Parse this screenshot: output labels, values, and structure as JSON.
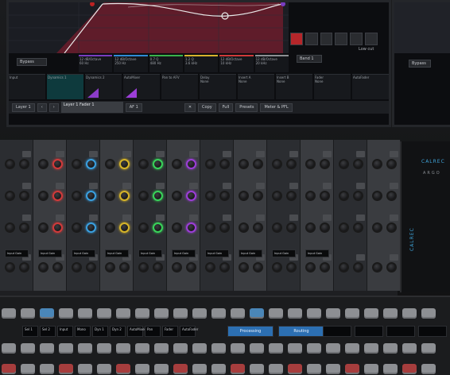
{
  "main_screen": {
    "eq": {
      "curve_color": "#e4e4e4",
      "fill_color": "#6b1c2c",
      "bypass_label": "Bypass",
      "band_label": "Band 1",
      "lowcut_label": "Low cut",
      "bands": [
        {
          "line1": "12 dB/Octave",
          "line2": "60 Hz"
        },
        {
          "line1": "12 dB/Octave",
          "line2": "250 Hz"
        },
        {
          "line1": "0.7 Q",
          "line2": "480 Hz"
        },
        {
          "line1": "1.2 Q",
          "line2": "3.6 kHz"
        },
        {
          "line1": "12 dB/Octave",
          "line2": "10 kHz"
        },
        {
          "line1": "12 dB/Octave",
          "line2": "20 kHz"
        }
      ]
    },
    "strip_tabs": [
      {
        "label": "Input",
        "value": ""
      },
      {
        "label": "Dynamics 1",
        "value": ""
      },
      {
        "label": "Dynamics 2",
        "value": ""
      },
      {
        "label": "AutoMixer",
        "value": ""
      },
      {
        "label": "Pan to AFV",
        "value": ""
      },
      {
        "label": "Delay",
        "value": "None"
      },
      {
        "label": "Insert A",
        "value": "None"
      },
      {
        "label": "Insert B",
        "value": "None"
      },
      {
        "label": "Fader",
        "value": "None"
      },
      {
        "label": "AutoFader",
        "value": ""
      }
    ],
    "bottom_bar": {
      "layer_label": "Layer",
      "layer_number": "1",
      "fader_info": "Layer 1 Fader 1",
      "copy_label": "Copy",
      "full_label": "Full",
      "presets_label": "Presets",
      "meter_label": "Meter & PFL",
      "af_label": "AF 1"
    }
  },
  "console": {
    "knob_colors": [
      "#d13a3a",
      "#3aa0e0",
      "#d6b428",
      "#39d35a",
      "#9c3ed8",
      "#2fc4c4",
      "#d07ac4"
    ],
    "displays": [
      "Input Gain",
      "Input Gain",
      "Input Gain",
      "Input Gain",
      "Input Gain",
      "Input Gain",
      "Input Gain",
      "Input Gain",
      "Input Gain",
      "Input Gain"
    ],
    "logo": "CALREC",
    "model": "ARGO"
  },
  "lower_panel": {
    "lcd_labels": [
      "Sel 1",
      "Sel 2",
      "Input",
      "Mono",
      "Dyn 1",
      "Dyn 2",
      "AutoMixer",
      "Pan",
      "Fader",
      "AutoFader"
    ],
    "blue_buttons": [
      "Processing",
      "Routing"
    ]
  }
}
